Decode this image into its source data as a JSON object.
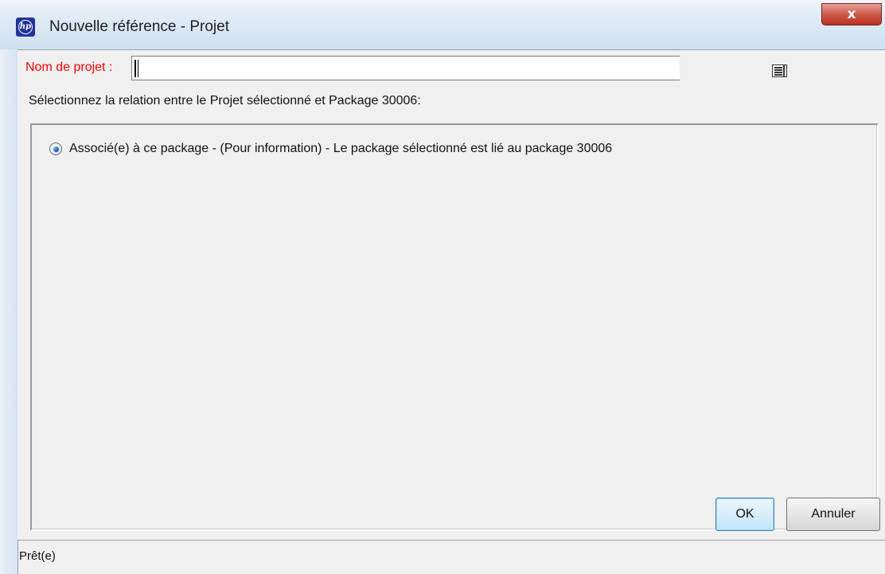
{
  "window": {
    "title": "Nouvelle référence - Projet",
    "close_label": "x"
  },
  "form": {
    "project_label": "Nom de projet :",
    "project_value": "",
    "instruction": "Sélectionnez la relation entre le Projet sélectionné et Package 30006:"
  },
  "relation": {
    "options": [
      {
        "label": "Associé(e) à ce package - (Pour information) - Le package sélectionné est lié au package 30006",
        "selected": true
      }
    ]
  },
  "buttons": {
    "ok_label": "OK",
    "cancel_label": "Annuler"
  },
  "status": {
    "text": "Prêt(e)"
  },
  "colors": {
    "required_label": "#ff0000",
    "close_button": "#c4402f",
    "hp_logo": "#20339a"
  },
  "icons": {
    "app": "hp-logo-icon",
    "picker": "list-picker-icon",
    "close": "close-icon"
  }
}
